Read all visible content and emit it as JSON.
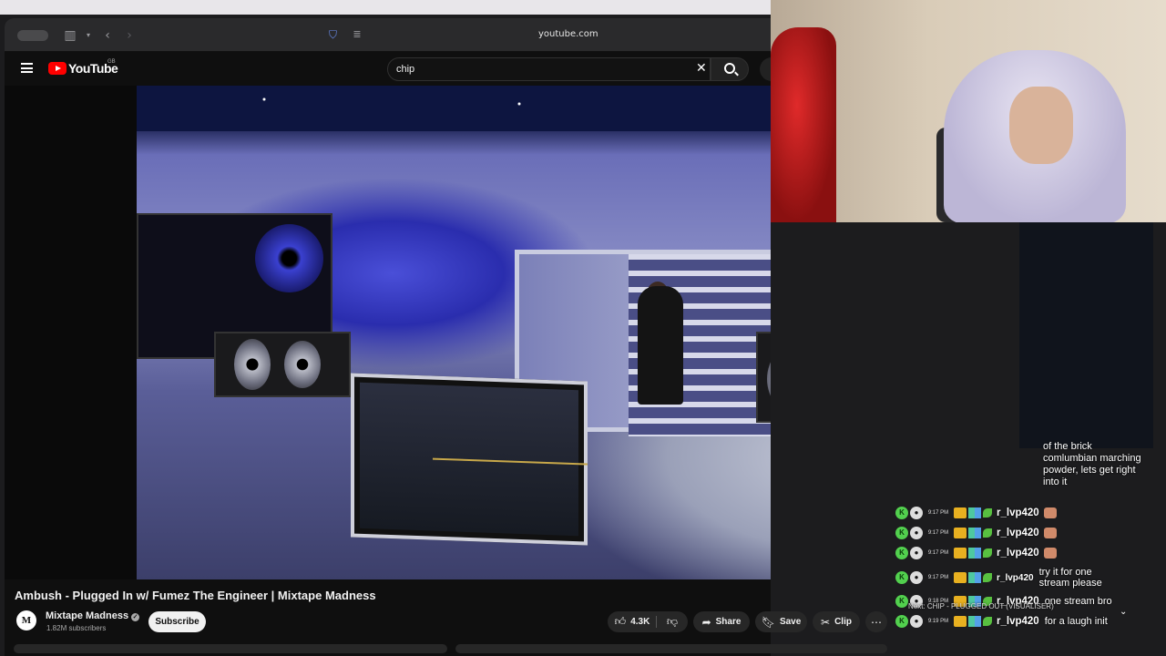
{
  "browser": {
    "url": "youtube.com"
  },
  "youtube": {
    "logo_text": "YouTube",
    "region": "GB",
    "search_value": "chip"
  },
  "video": {
    "title": "Ambush - Plugged In w/ Fumez The Engineer | Mixtape Madness",
    "channel": "Mixtape Madness",
    "channel_avatar": "M",
    "verified": "✓",
    "subscribers": "1.82M subscribers",
    "subscribe_label": "Subscribe",
    "likes": "4.3K",
    "share_label": "Share",
    "save_label": "Save",
    "clip_label": "Clip",
    "more_label": "⋯"
  },
  "chat": {
    "previous_message": "of the brick comlumbian marching powder, lets get right into it",
    "messages": [
      {
        "time": "9:17 PM",
        "user": "r_lvp420",
        "text": ""
      },
      {
        "time": "9:17 PM",
        "user": "r_lvp420",
        "text": ""
      },
      {
        "time": "9:17 PM",
        "user": "r_lvp420",
        "text": ""
      },
      {
        "time": "9:17 PM",
        "user": "r_lvp420",
        "text": "try it for one stream please"
      },
      {
        "time": "9:18 PM",
        "user": "r_lvp420",
        "text": "one stream bro"
      },
      {
        "time": "9:19 PM",
        "user": "r_lvp420",
        "text": "for a laugh init"
      }
    ],
    "next_label": "Next: CHIP - PLUGGED OUT (VISUALISER)"
  },
  "icons": {
    "apple": "apple-icon",
    "sidebar": "sidebar-icon",
    "back": "back-arrow-icon",
    "forward": "forward-arrow-icon",
    "shield": "privacy-shield-icon",
    "reader": "reader-icon",
    "menu": "hamburger-menu-icon",
    "search": "search-icon",
    "clear": "close-icon",
    "like": "thumbs-up-icon",
    "dislike": "thumbs-down-icon",
    "share": "share-icon",
    "save": "bookmark-icon",
    "clip": "scissors-icon"
  }
}
